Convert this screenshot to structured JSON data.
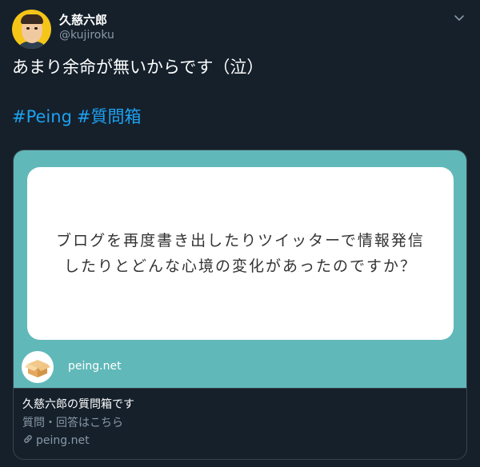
{
  "user": {
    "display_name": "久慈六郎",
    "handle": "@kujiroku"
  },
  "tweet": {
    "text": "あまり余命が無いからです（泣）",
    "hashtags": [
      "#Peing",
      "#質問箱"
    ]
  },
  "card": {
    "question": "ブログを再度書き出したりツイッターで情報発信したりとどんな心境の変化があったのですか？",
    "media_domain": "peing.net",
    "title": "久慈六郎の質問箱です",
    "description": "質問・回答はこちら",
    "link_domain": "peing.net"
  },
  "colors": {
    "background": "#15202b",
    "hashtag": "#1da1f2",
    "card_media": "#61b8b9",
    "muted_text": "#8899a6"
  },
  "icons": {
    "caret": "chevron-down-icon",
    "link": "link-icon"
  }
}
